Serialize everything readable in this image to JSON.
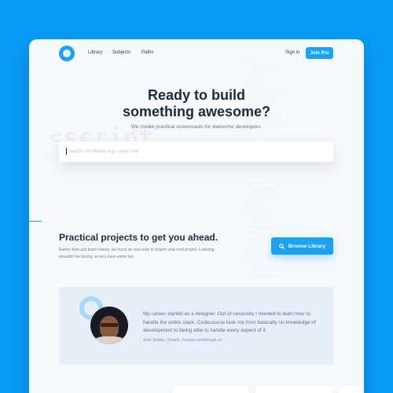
{
  "nav": {
    "links": [
      "Library",
      "Subjects",
      "Paths"
    ],
    "signin": "Sign in",
    "join": "Join Pro"
  },
  "hero": {
    "title_line1": "Ready to build",
    "title_line2": "something awesome?",
    "subtitle": "We create practical screencasts for awesome developers.",
    "search_placeholder": "Search our library, e.g. Learn Vue",
    "bg_word": "<script"
  },
  "projects": {
    "title": "Practical projects to get you ahead.",
    "text": "Rather than just teach theory, we focus on real code to inspire your next project. Learning shouldn't be boring, so let's have some fun.",
    "button": "Browse Library"
  },
  "testimonial": {
    "quote": "My career started as a designer. Out of necessity I needed to learn how to handle the entire stack. Codecourse took me from basically no knowledge of development to being able to handle every aspect of it.",
    "author": "Josh Stobbs, Ontario, Canada anvildesign.ca"
  },
  "colors": {
    "accent": "#1da1f2",
    "page_bg": "#0a9cf5"
  }
}
